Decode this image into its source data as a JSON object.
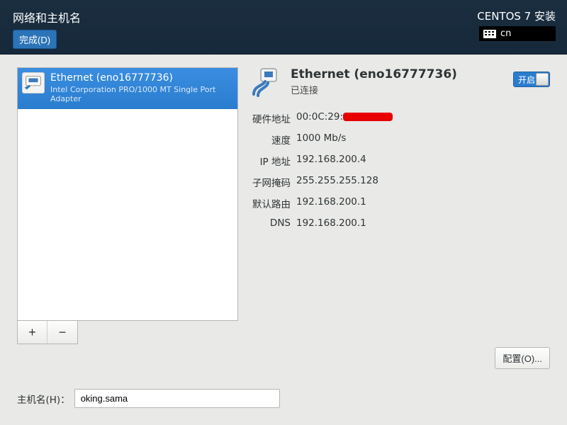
{
  "header": {
    "title": "网络和主机名",
    "done_label": "完成(D)",
    "installer_title": "CENTOS 7 安装",
    "lang_code": "cn"
  },
  "left": {
    "interface": {
      "name": "Ethernet (eno16777736)",
      "description": "Intel Corporation PRO/1000 MT Single Port Adapter"
    },
    "add_label": "+",
    "remove_label": "−"
  },
  "right": {
    "title": "Ethernet (eno16777736)",
    "status": "已连接",
    "toggle_label": "开启",
    "details": {
      "hw_label": "硬件地址",
      "hw_value": "00:0C:29:",
      "speed_label": "速度",
      "speed_value": "1000 Mb/s",
      "ip_label": "IP 地址",
      "ip_value": "192.168.200.4",
      "mask_label": "子网掩码",
      "mask_value": "255.255.255.128",
      "gw_label": "默认路由",
      "gw_value": "192.168.200.1",
      "dns_label": "DNS",
      "dns_value": "192.168.200.1"
    },
    "config_label": "配置(O)..."
  },
  "hostname": {
    "label": "主机名(H)：",
    "value": "oking.sama"
  }
}
